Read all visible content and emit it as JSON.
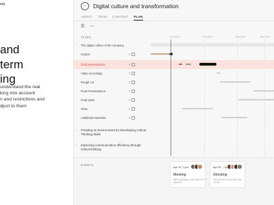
{
  "left": {
    "logo": "ory",
    "headline": "and\nterm\ning",
    "body": "understand the real\nking into account\nn and restrictions and\ndjust to them"
  },
  "header": {
    "title": "Digital culture and transformation",
    "back_icon": "arrow-left-icon"
  },
  "tabs": [
    {
      "label": "ABOUT"
    },
    {
      "label": "TEAM"
    },
    {
      "label": "CONTENT"
    },
    {
      "label": "PLAN",
      "active": true
    }
  ],
  "view_toggles": [
    "gantt-view-icon",
    "list-view-icon"
  ],
  "timeline": {
    "tasks_header": "TASKS",
    "dates": [
      "Jan 2024",
      "Feb 2024",
      "Mar 2024",
      "Apr 2024"
    ]
  },
  "tasks": [
    {
      "name": "The digital culture of the company",
      "count": "",
      "expand": "›"
    },
    {
      "name": "Scripts",
      "count": "8"
    },
    {
      "name": "Draft presentations",
      "count": "8",
      "highlight": true
    },
    {
      "name": "Video recordings",
      "count": "8"
    },
    {
      "name": "Rough cut",
      "count": "8"
    },
    {
      "name": "Final Presentations",
      "count": "8"
    },
    {
      "name": "Final video",
      "count": "8"
    },
    {
      "name": "Tests",
      "count": "8"
    },
    {
      "name": "Additional materials",
      "count": "8"
    }
  ],
  "subprojects": [
    {
      "name": "Creating an Environment for Developing Critical Thinking Skills",
      "expand": "›"
    },
    {
      "name": "Improving communication efficiency through critical thinking",
      "expand": "›"
    }
  ],
  "events": {
    "label": "EVENTS",
    "items": [
      {
        "date": "Apr 10, 2 pm",
        "kind": "Meeting",
        "address": "https://us04web.zoom.us/j/7923...?pwd=k0Y..."
      },
      {
        "date": "Apr 25 — Apr 26",
        "kind": "Shooting",
        "address": "3670 Beachem Ave San Jose, CA 95..."
      }
    ]
  },
  "colors": {
    "accent_red": "#d24b3c",
    "tan": "#c3a77d",
    "highlight_row": "#fbe2df"
  }
}
